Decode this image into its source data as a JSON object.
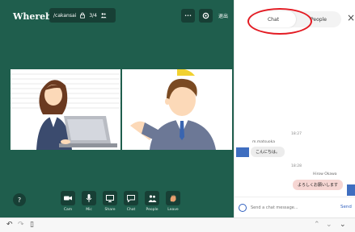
{
  "app": {
    "logo": "Whereby"
  },
  "room": {
    "name": "/cakansai",
    "count": "3/4"
  },
  "toolbar": {
    "more_label": "•••",
    "exit_label": "退出"
  },
  "controls": [
    {
      "label": "Cam",
      "icon": "camera-icon"
    },
    {
      "label": "Mic",
      "icon": "mic-icon"
    },
    {
      "label": "Share",
      "icon": "screen-share-icon"
    },
    {
      "label": "Chat",
      "icon": "chat-icon"
    },
    {
      "label": "People",
      "icon": "people-icon"
    },
    {
      "label": "Leave",
      "icon": "leave-icon"
    }
  ],
  "help_label": "?",
  "chat": {
    "tabs": [
      {
        "label": "Chat",
        "active": true
      },
      {
        "label": "People",
        "active": false
      }
    ],
    "close_label": "×",
    "messages": [
      {
        "time": "18:27",
        "sender": "m.matsuoka",
        "text": "こんにちは。",
        "direction": "in"
      },
      {
        "time": "18:28",
        "sender": "Hirow Okawa",
        "text": "よろしくお願いします",
        "direction": "out"
      }
    ],
    "compose": {
      "placeholder": "Send a chat message...",
      "send_label": "Send"
    }
  },
  "colors": {
    "video_bg": "#1f5e4d",
    "control_bg": "#173f35",
    "annotation": "#e31b23",
    "avatar": "#3f6ec0"
  }
}
